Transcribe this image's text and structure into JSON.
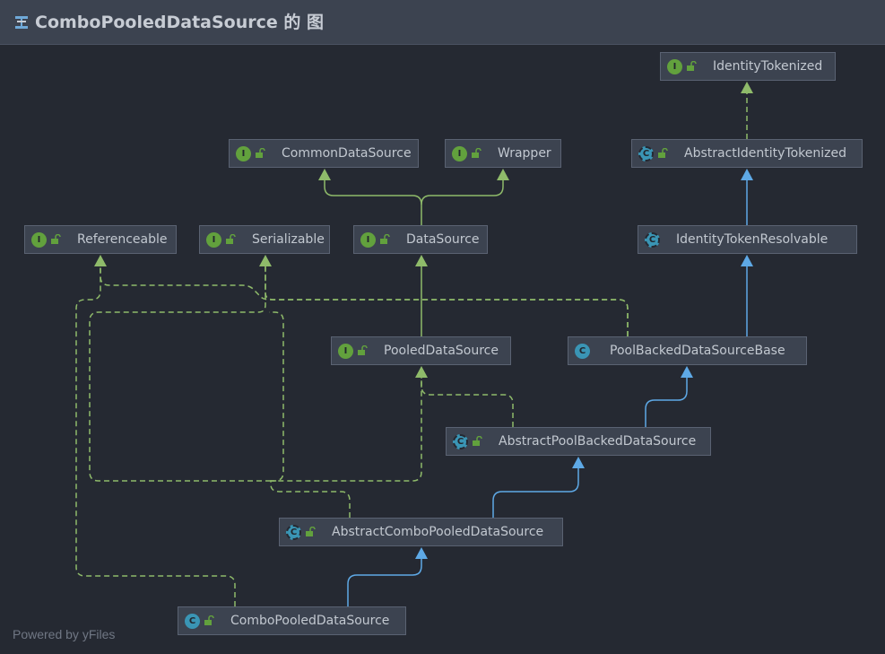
{
  "header": {
    "title": "ComboPooledDataSource 的 图"
  },
  "nodes": {
    "identity_tokenized": {
      "label": "IdentityTokenized",
      "kind": "I"
    },
    "common_data_source": {
      "label": "CommonDataSource",
      "kind": "I"
    },
    "wrapper": {
      "label": "Wrapper",
      "kind": "I"
    },
    "abstract_identity_tokenized": {
      "label": "AbstractIdentityTokenized",
      "kind": "C"
    },
    "referenceable": {
      "label": "Referenceable",
      "kind": "I"
    },
    "serializable": {
      "label": "Serializable",
      "kind": "I"
    },
    "data_source": {
      "label": "DataSource",
      "kind": "I"
    },
    "identity_token_resolvable": {
      "label": "IdentityTokenResolvable",
      "kind": "C"
    },
    "pooled_data_source": {
      "label": "PooledDataSource",
      "kind": "I"
    },
    "pool_backed_data_source_base": {
      "label": "PoolBackedDataSourceBase",
      "kind": "C"
    },
    "abstract_pool_backed_data_source": {
      "label": "AbstractPoolBackedDataSource",
      "kind": "C"
    },
    "abstract_combo_pooled_data_source": {
      "label": "AbstractComboPooledDataSource",
      "kind": "C"
    },
    "combo_pooled_data_source": {
      "label": "ComboPooledDataSource",
      "kind": "C"
    }
  },
  "footer": {
    "text": "Powered by yFiles"
  },
  "colors": {
    "implements_edge": "#8fbb6a",
    "extends_edge": "#5ea9e6",
    "interface_badge": "#62a13d",
    "class_badge": "#3a95b5"
  }
}
